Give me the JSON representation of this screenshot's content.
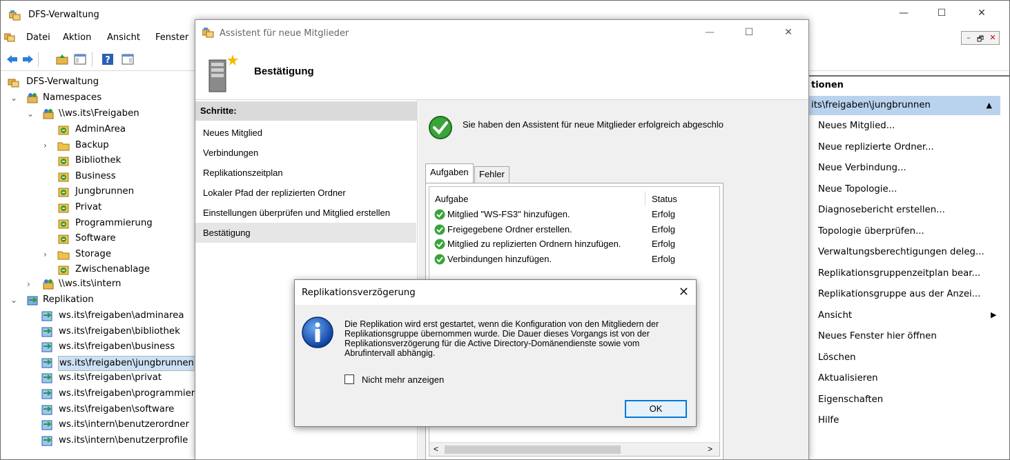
{
  "main": {
    "title": "DFS-Verwaltung",
    "window_controls": [
      "—",
      "☐",
      "✕"
    ],
    "menu": [
      "Datei",
      "Aktion",
      "Ansicht",
      "Fenster"
    ],
    "mdi_controls": [
      "–",
      "🗗",
      "✕"
    ]
  },
  "tree": {
    "root": "DFS-Verwaltung",
    "namespaces": "Namespaces",
    "ns1": "\\\\ws.its\\Freigaben",
    "ns1_children": [
      "AdminArea",
      "Backup",
      "Bibliothek",
      "Business",
      "Jungbrunnen",
      "Privat",
      "Programmierung",
      "Software",
      "Storage",
      "Zwischenablage"
    ],
    "ns2": "\\\\ws.its\\intern",
    "replikation": "Replikation",
    "repl_children": [
      "ws.its\\freigaben\\adminarea",
      "ws.its\\freigaben\\bibliothek",
      "ws.its\\freigaben\\business",
      "ws.its\\freigaben\\jungbrunnen",
      "ws.its\\freigaben\\privat",
      "ws.its\\freigaben\\programmier",
      "ws.its\\freigaben\\software",
      "ws.its\\intern\\benutzerordner",
      "ws.its\\intern\\benutzerprofile"
    ]
  },
  "actions": {
    "section": "tionen",
    "group": "its\\freigaben\\jungbrunnen",
    "group_caret": "▲",
    "items": [
      "Neues Mitglied...",
      "Neue replizierte Ordner...",
      "Neue Verbindung...",
      "Neue Topologie...",
      "Diagnosebericht erstellen...",
      "Topologie überprüfen...",
      "Verwaltungsberechtigungen deleg...",
      "Replikationsgruppenzeitplan bear...",
      "Replikationsgruppe aus der Anzei...",
      "Ansicht",
      "Neues Fenster hier öffnen",
      "Löschen",
      "Aktualisieren",
      "Eigenschaften",
      "Hilfe"
    ],
    "submenu_arrow": "▶"
  },
  "wizard": {
    "title": "Assistent für neue Mitglieder",
    "window_controls": [
      "—",
      "☐",
      "✕"
    ],
    "heading": "Bestätigung",
    "steps_header": "Schritte:",
    "steps": [
      "Neues Mitglied",
      "Verbindungen",
      "Replikationszeitplan",
      "Lokaler Pfad der replizierten Ordner",
      "Einstellungen überprüfen und Mitglied erstellen",
      "Bestätigung"
    ],
    "success_msg": "Sie haben den Assistent für neue Mitglieder erfolgreich abgeschlo",
    "tabs": [
      "Aufgaben",
      "Fehler"
    ],
    "table": {
      "columns": [
        "Aufgabe",
        "Status"
      ],
      "rows": [
        {
          "task": "Mitglied \"WS-FS3\" hinzufügen.",
          "status": "Erfolg"
        },
        {
          "task": "Freigegebene Ordner erstellen.",
          "status": "Erfolg"
        },
        {
          "task": "Mitglied zu replizierten Ordnern hinzufügen.",
          "status": "Erfolg"
        },
        {
          "task": "Verbindungen hinzufügen.",
          "status": "Erfolg"
        }
      ]
    },
    "scroll_left": "<",
    "scroll_right": ">"
  },
  "msgbox": {
    "title": "Replikationsverzögerung",
    "close": "✕",
    "text": "Die Replikation wird erst gestartet, wenn die Konfiguration von den Mitgliedern der Replikationsgruppe übernommen wurde. Die Dauer dieses Vorgangs ist von der Replikationsverzögerung für die Active Directory-Domänendienste sowie vom Abrufintervall abhängig.",
    "checkbox_label": "Nicht mehr anzeigen",
    "ok": "OK"
  }
}
